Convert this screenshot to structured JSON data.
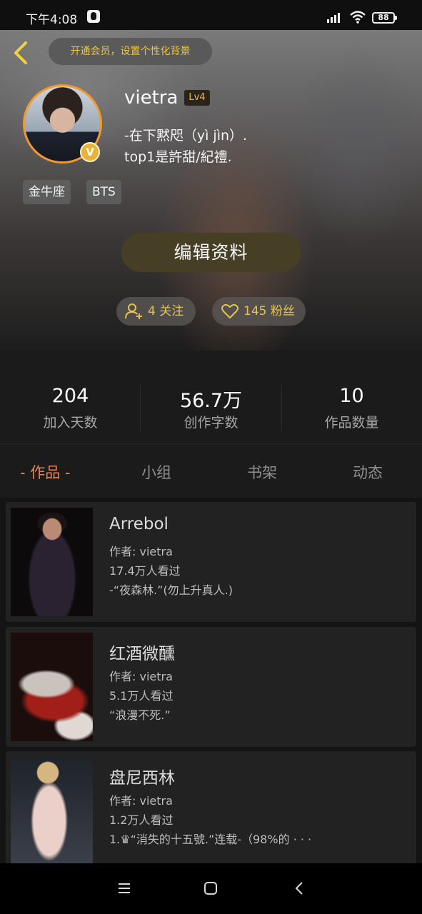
{
  "status_bar": {
    "time": "下午4:08",
    "battery": "88"
  },
  "header": {
    "member_prompt": "开通会员，设置个性化背景",
    "username": "vietra",
    "level": "Lv4",
    "vip_badge": "V",
    "bio_line_1": "-在下黙咫（yì jìn）.",
    "bio_line_2": "top1是許甜/紀禮.",
    "tags": [
      "金牛座",
      "BTS"
    ],
    "edit_button": "编辑资料",
    "follow": "4 关注",
    "fans": "145 粉丝"
  },
  "stats": [
    {
      "value": "204",
      "label": "加入天数"
    },
    {
      "value": "56.7万",
      "label": "创作字数"
    },
    {
      "value": "10",
      "label": "作品数量"
    }
  ],
  "tabs": [
    "- 作品 -",
    "小组",
    "书架",
    "动态"
  ],
  "works": [
    {
      "title": "Arrebol",
      "author": "作者: vietra",
      "views": "17.4万人看过",
      "intro": "-“夜森林.”(勿上升真人.)"
    },
    {
      "title": "红酒微醺",
      "author": "作者: vietra",
      "views": "5.1万人看过",
      "intro": "“浪漫不死.”"
    },
    {
      "title": "盘尼西林",
      "author": "作者: vietra",
      "views": "1.2万人看过",
      "intro": "1.♛“消失的十五號.”连载-（98%的 · · ·"
    }
  ],
  "colors": {
    "accent": "#e8835a",
    "gold": "#efc53a",
    "avatar_ring": "#f29a2f"
  },
  "icons": [
    "back-arrow-icon",
    "vip-badge-icon",
    "add-user-icon",
    "heart-icon",
    "menu-icon",
    "home-square-icon",
    "back-nav-icon",
    "signal-icon",
    "wifi-icon",
    "battery-icon"
  ]
}
